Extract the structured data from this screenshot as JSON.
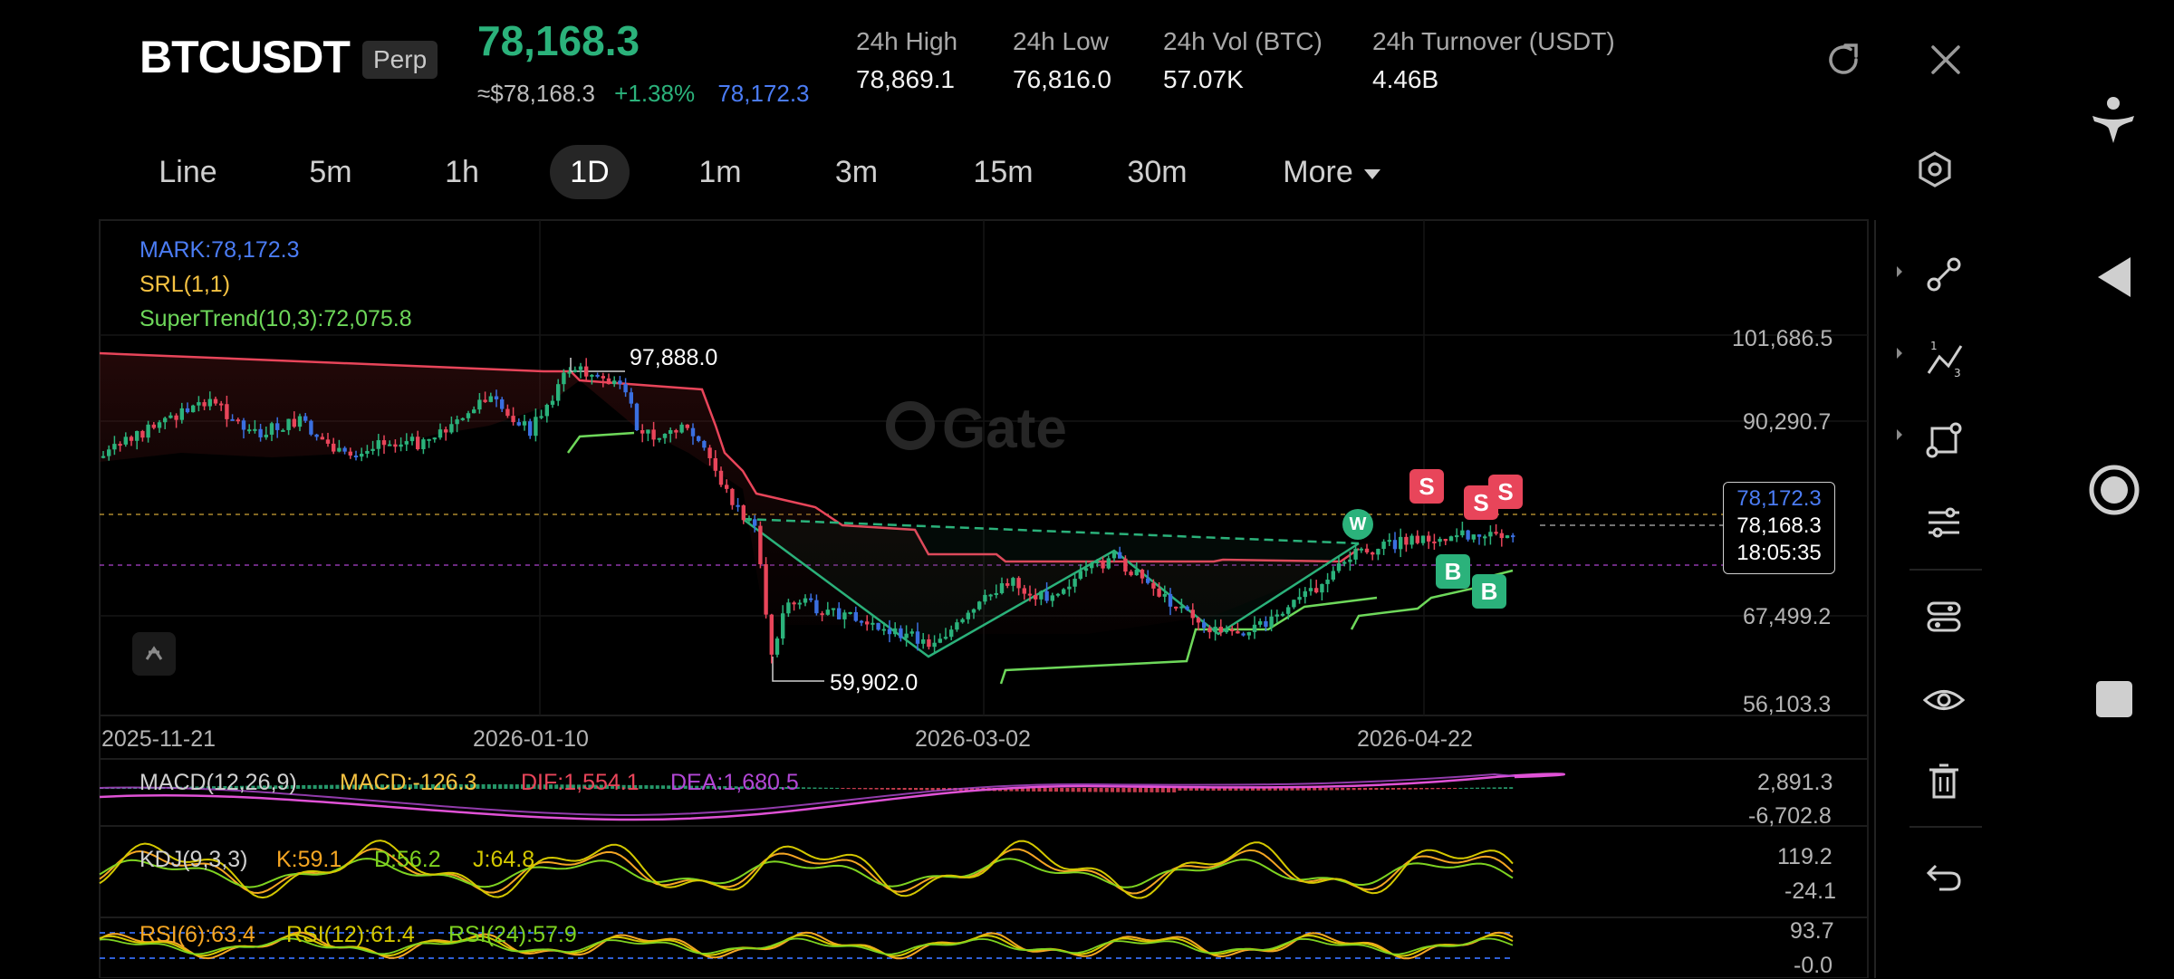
{
  "header": {
    "symbol": "BTCUSDT",
    "badge": "Perp",
    "price": "78,168.3",
    "usd_price": "≈$78,168.3",
    "change_pct": "+1.38%",
    "mark_price": "78,172.3",
    "stats": [
      {
        "label": "24h  High",
        "value": "78,869.1"
      },
      {
        "label": "24h  Low",
        "value": "76,816.0"
      },
      {
        "label": "24h  Vol (BTC)",
        "value": "57.07K"
      },
      {
        "label": "24h  Turnover (USDT)",
        "value": "4.46B"
      }
    ]
  },
  "timeframes": [
    "Line",
    "5m",
    "1h",
    "1D",
    "1m",
    "3m",
    "15m",
    "30m"
  ],
  "active_timeframe": "1D",
  "more_label": "More",
  "legend": {
    "mark": "MARK:78,172.3",
    "srl": "SRL(1,1)",
    "supertrend": "SuperTrend(10,3):72,075.8"
  },
  "price_axis": [
    "101,686.5",
    "90,290.7",
    "67,499.2",
    "56,103.3"
  ],
  "date_axis": [
    "2025-11-21",
    "2026-01-10",
    "2026-03-02",
    "2026-04-22"
  ],
  "annotations": {
    "high": "97,888.0",
    "low": "59,902.0"
  },
  "price_tag": {
    "mark": "78,172.3",
    "last": "78,168.3",
    "countdown": "18:05:35"
  },
  "signals": {
    "sell": "S",
    "buy": "B",
    "warn": "W"
  },
  "watermark": "Gate",
  "macd": {
    "name": "MACD(12,26,9)",
    "macd": "MACD:-126.3",
    "dif": "DIF:1,554.1",
    "dea": "DEA:1,680.5",
    "axis": [
      "2,891.3",
      "-6,702.8"
    ]
  },
  "kdj": {
    "name": "KDJ(9,3,3)",
    "k": "K:59.1",
    "d": "D:56.2",
    "j": "J:64.8",
    "axis": [
      "119.2",
      "-24.1"
    ]
  },
  "rsi": {
    "name": "RSI(6):63.4",
    "rsi12": "RSI(12):61.4",
    "rsi24": "RSI(24):57.9",
    "axis": [
      "93.7",
      "-0.0"
    ]
  },
  "colors": {
    "up": "#2bb27b",
    "down": "#e8455a",
    "mark": "#4b7cf4",
    "srl": "#f5c242",
    "supertrend": "#6ed85a",
    "macd_line": "#e052d6",
    "kdj_k": "#f5a623",
    "kdj_d": "#7ed321",
    "kdj_j": "#d4c800"
  }
}
